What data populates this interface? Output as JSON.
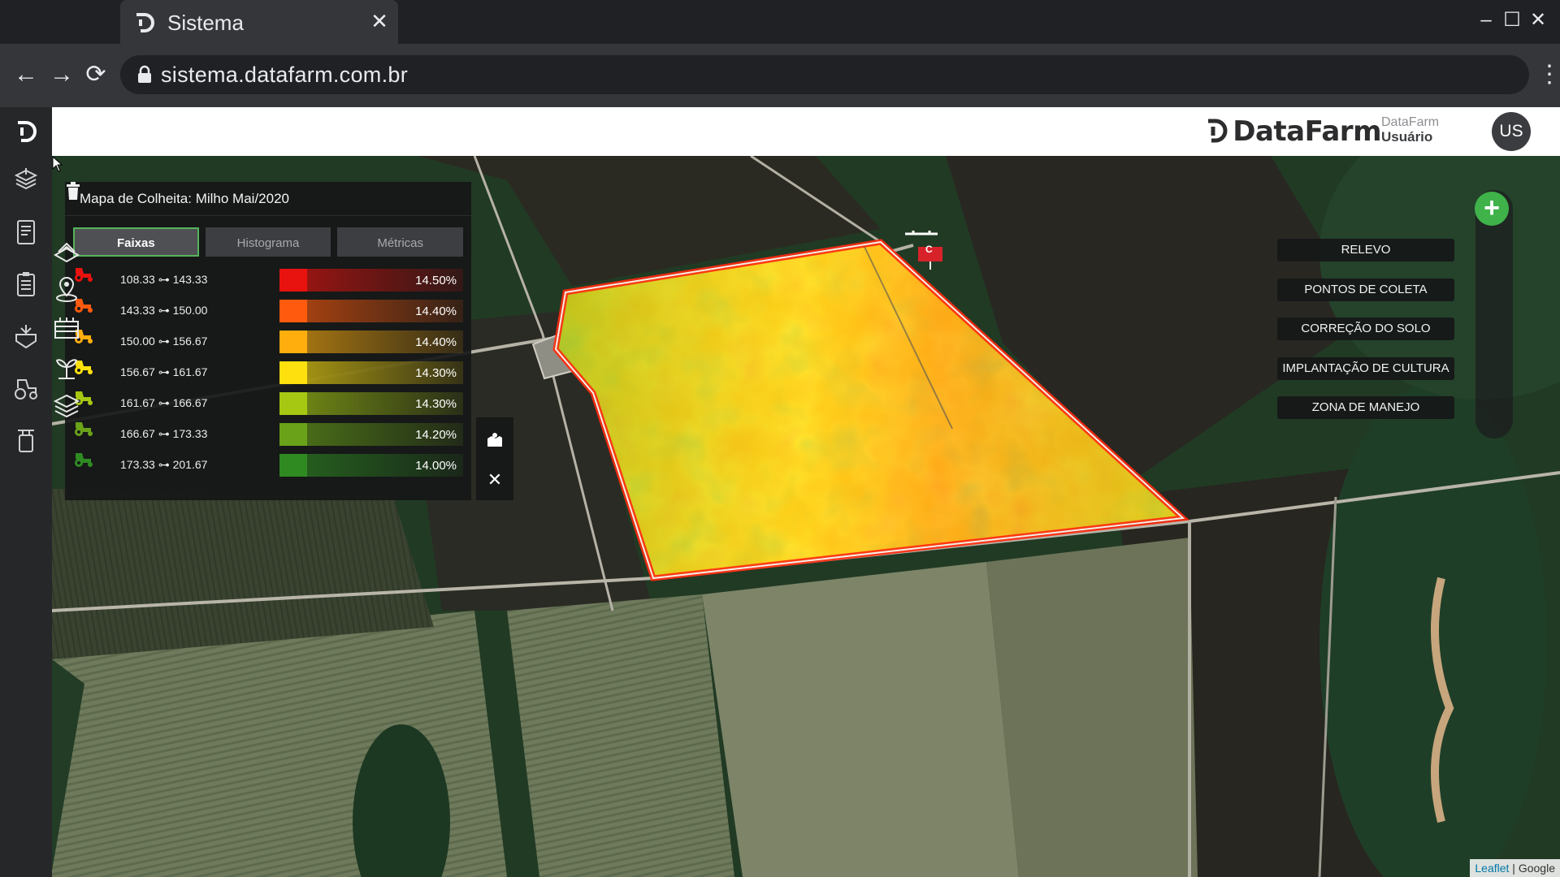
{
  "browser": {
    "tab_title": "Sistema",
    "tab_close": "✕",
    "url": "sistema.datafarm.com.br",
    "back": "←",
    "forward": "→",
    "reload": "⟳",
    "menu": "⋮",
    "minimize": "–",
    "maximize": "☐",
    "close": "✕"
  },
  "header": {
    "brand": "DataFarm",
    "org": "DataFarm",
    "user": "Usuário",
    "avatar_initials": "US"
  },
  "legend": {
    "title": "Mapa de Colheita: Milho Mai/2020",
    "tabs": [
      "Faixas",
      "Histograma",
      "Métricas"
    ],
    "rows": [
      {
        "range": "108.33 ⊶ 143.33",
        "pct": "14.50%",
        "color": "#e8120e"
      },
      {
        "range": "143.33 ⊶ 150.00",
        "pct": "14.40%",
        "color": "#ff5a0d"
      },
      {
        "range": "150.00 ⊶ 156.67",
        "pct": "14.40%",
        "color": "#ffae0e"
      },
      {
        "range": "156.67 ⊶ 161.67",
        "pct": "14.30%",
        "color": "#ffe00f"
      },
      {
        "range": "161.67 ⊶ 166.67",
        "pct": "14.30%",
        "color": "#a7c813"
      },
      {
        "range": "166.67 ⊶ 173.33",
        "pct": "14.20%",
        "color": "#6aa219"
      },
      {
        "range": "173.33 ⊶ 201.67",
        "pct": "14.00%",
        "color": "#2f8a22"
      }
    ]
  },
  "tools": {
    "close": "✕"
  },
  "layers": {
    "add": "+",
    "items": [
      "RELEVO",
      "PONTOS DE COLETA",
      "CORREÇÃO DO SOLO",
      "IMPLANTAÇÃO DE CULTURA",
      "ZONA DE MANEJO"
    ]
  },
  "map": {
    "marker_label": "C",
    "attribution_leaflet": "Leaflet",
    "attribution_sep": " | ",
    "attribution_google": "Google"
  },
  "colors": {
    "accent_green": "#3fb24a",
    "sidebar": "#262729"
  }
}
